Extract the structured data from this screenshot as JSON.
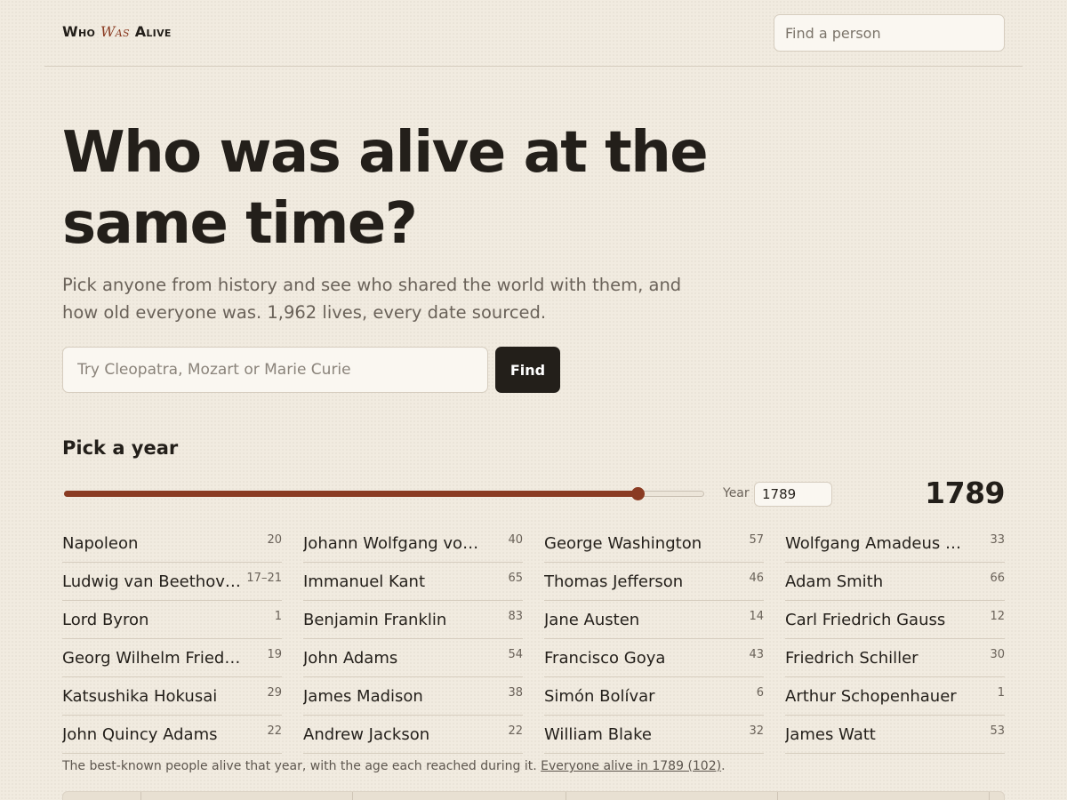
{
  "header": {
    "logo_who": "Who",
    "logo_was": "Was",
    "logo_alive": "Alive",
    "search_placeholder": "Find a person"
  },
  "hero": {
    "title": "Who was alive at the same time?",
    "subtitle": "Pick anyone from history and see who shared the world with them, and how old everyone was. 1,962 lives, every date sourced.",
    "search_placeholder": "Try Cleopatra, Mozart or Marie Curie",
    "find_label": "Find"
  },
  "year_picker": {
    "heading": "Pick a year",
    "slider_fraction": 0.895,
    "year_label": "Year",
    "year_value": "1789",
    "year_display": "1789"
  },
  "people": [
    {
      "name": "Napoleon",
      "age": "20"
    },
    {
      "name": "Johann Wolfgang von Goethe",
      "age": "40"
    },
    {
      "name": "George Washington",
      "age": "57"
    },
    {
      "name": "Wolfgang Amadeus Mozart",
      "age": "33"
    },
    {
      "name": "Ludwig van Beethoven",
      "age": "17–21"
    },
    {
      "name": "Immanuel Kant",
      "age": "65"
    },
    {
      "name": "Thomas Jefferson",
      "age": "46"
    },
    {
      "name": "Adam Smith",
      "age": "66"
    },
    {
      "name": "Lord Byron",
      "age": "1"
    },
    {
      "name": "Benjamin Franklin",
      "age": "83"
    },
    {
      "name": "Jane Austen",
      "age": "14"
    },
    {
      "name": "Carl Friedrich Gauss",
      "age": "12"
    },
    {
      "name": "Georg Wilhelm Friedrich Hegel",
      "age": "19"
    },
    {
      "name": "John Adams",
      "age": "54"
    },
    {
      "name": "Francisco Goya",
      "age": "43"
    },
    {
      "name": "Friedrich Schiller",
      "age": "30"
    },
    {
      "name": "Katsushika Hokusai",
      "age": "29"
    },
    {
      "name": "James Madison",
      "age": "38"
    },
    {
      "name": "Simón Bolívar",
      "age": "6"
    },
    {
      "name": "Arthur Schopenhauer",
      "age": "1"
    },
    {
      "name": "John Quincy Adams",
      "age": "22"
    },
    {
      "name": "Andrew Jackson",
      "age": "22"
    },
    {
      "name": "William Blake",
      "age": "32"
    },
    {
      "name": "James Watt",
      "age": "53"
    }
  ],
  "caption": {
    "text": "The best-known people alive that year, with the age each reached during it.",
    "link": "Everyone alive in 1789 (102)",
    "end": "."
  }
}
